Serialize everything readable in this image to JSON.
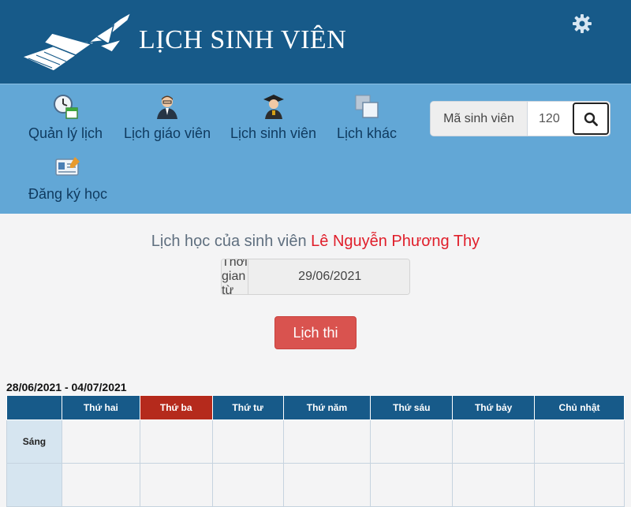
{
  "header": {
    "title": "LỊCH SINH VIÊN",
    "logo_icon": "paper-plane-icon",
    "settings_icon": "gear-icon"
  },
  "nav": [
    {
      "label": "Quản lý lịch",
      "icon": "clock-calendar-icon"
    },
    {
      "label": "Lịch giáo viên",
      "icon": "teacher-icon"
    },
    {
      "label": "Lịch sinh viên",
      "icon": "graduate-icon"
    },
    {
      "label": "Lịch khác",
      "icon": "stacked-windows-icon"
    },
    {
      "label": "Đăng ký học",
      "icon": "id-card-icon"
    }
  ],
  "search": {
    "label": "Mã sinh viên",
    "value": "120",
    "button_icon": "search-icon"
  },
  "heading": {
    "prefix": "Lịch học của sinh viên ",
    "student_name": "Lê Nguyễn Phương Thy"
  },
  "date_filter": {
    "label": "Thời gian từ",
    "value": "29/06/2021"
  },
  "exam_button": "Lịch thi",
  "schedule": {
    "week_range": "28/06/2021 - 04/07/2021",
    "days": [
      "Thứ hai",
      "Thứ ba",
      "Thứ tư",
      "Thứ năm",
      "Thứ sáu",
      "Thứ bảy",
      "Chủ nhật"
    ],
    "highlighted_day": "Thứ ba",
    "rows": [
      "Sáng",
      ""
    ]
  },
  "colors": {
    "header_bg": "#175a89",
    "nav_bg": "#62a7d6",
    "accent_red": "#d9534f",
    "today_col": "#b52a1c",
    "student_name": "#e01e2a"
  }
}
